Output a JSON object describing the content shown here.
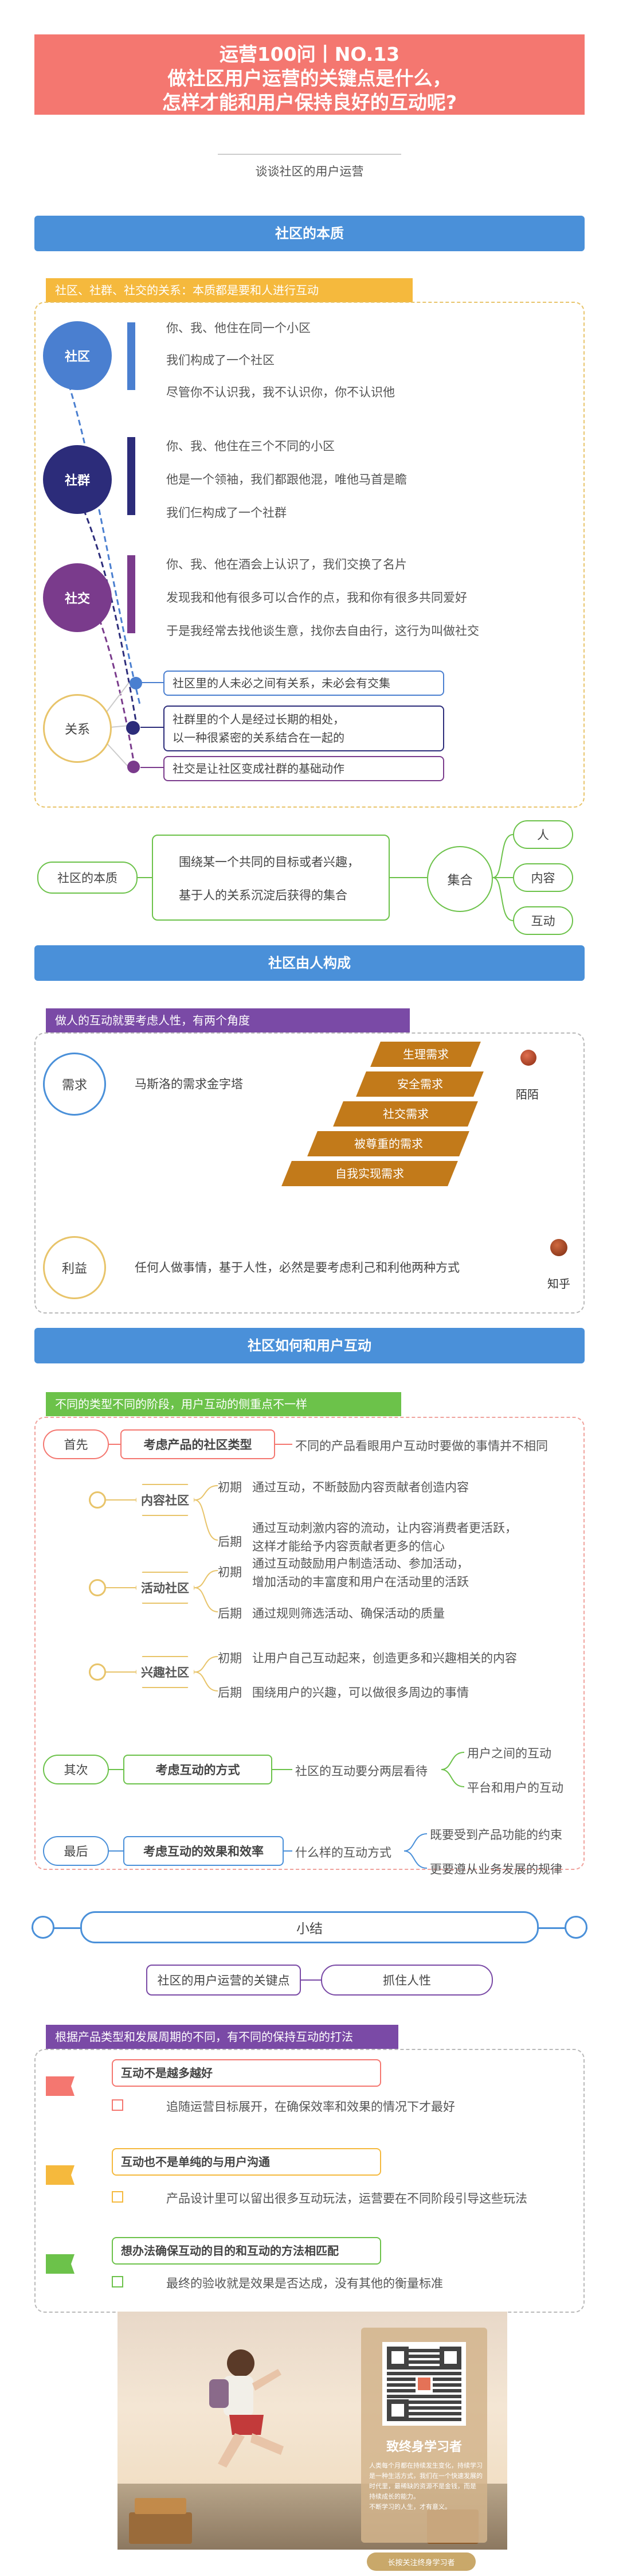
{
  "header": {
    "line1": "运营100问丨NO.13",
    "line2": "做社区用户运营的关键点是什么，",
    "line3": "怎样才能和用户保持良好的互动呢?"
  },
  "subtitle": "谈谈社区的用户运营",
  "sec1": {
    "title": "社区的本质",
    "tag": "社区、社群、社交的关系：本质都是要和人进行互动",
    "community": {
      "label": "社区",
      "lines": [
        "你、我、他住在同一个小区",
        "我们构成了一个社区",
        "尽管你不认识我，我不认识你，你不认识他"
      ]
    },
    "group": {
      "label": "社群",
      "lines": [
        "你、我、他住在三个不同的小区",
        "他是一个领袖，我们都跟他混，唯他马首是瞻",
        "我们仨构成了一个社群"
      ]
    },
    "social": {
      "label": "社交",
      "lines": [
        "你、我、他在酒会上认识了，我们交换了名片",
        "发现我和他有很多可以合作的点，我和你有很多共同爱好",
        "于是我经常去找他谈生意，找你去自由行，这行为叫做社交"
      ]
    },
    "relation": {
      "label": "关系",
      "items": [
        "社区里的人未必之间有关系，未必会有交集",
        "社群里的个人是经过长期的相处，\n以一种很紧密的关系结合在一起的",
        "社交是让社区变成社群的基础动作"
      ]
    },
    "essence": {
      "label": "社区的本质",
      "desc1": "围绕某一个共同的目标或者兴趣，",
      "desc2": "基于人的关系沉淀后获得的集合",
      "set": "集合",
      "items": [
        "人",
        "内容",
        "互动"
      ]
    }
  },
  "sec2": {
    "title": "社区由人构成",
    "tag": "做人的互动就要考虑人性，有两个角度",
    "need": {
      "label": "需求",
      "desc": "马斯洛的需求金字塔",
      "levels": [
        "生理需求",
        "安全需求",
        "社交需求",
        "被尊重的需求",
        "自我实现需求"
      ],
      "brand": "陌陌"
    },
    "benefit": {
      "label": "利益",
      "desc": "任何人做事情，基于人性，必然是要考虑利己和利他两种方式",
      "brand": "知乎"
    }
  },
  "sec3": {
    "title": "社区如何和用户互动",
    "tag": "不同的类型不同的阶段，用户互动的侧重点不一样",
    "first": {
      "label": "首先",
      "topic": "考虑产品的社区类型",
      "result": "不同的产品看眼用户互动时要做的事情并不相同"
    },
    "types": [
      {
        "label": "内容社区",
        "early": "初期",
        "early_text": "通过互动，不断鼓励内容贡献者创造内容",
        "late": "后期",
        "late_text": "通过互动刺激内容的流动，让内容消费者更活跃，\n这样才能给予内容贡献者更多的信心"
      },
      {
        "label": "活动社区",
        "early": "初期",
        "early_text": "通过互动鼓励用户制造活动、参加活动，\n增加活动的丰富度和用户在活动里的活跃",
        "late": "后期",
        "late_text": "通过规则筛选活动、确保活动的质量"
      },
      {
        "label": "兴趣社区",
        "early": "初期",
        "early_text": "让用户自己互动起来，创造更多和兴趣相关的内容",
        "late": "后期",
        "late_text": "围绕用户的兴趣，可以做很多周边的事情"
      }
    ],
    "second": {
      "label": "其次",
      "topic": "考虑互动的方式",
      "desc": "社区的互动要分两层看待",
      "items": [
        "用户之间的互动",
        "平台和用户的互动"
      ]
    },
    "last": {
      "label": "最后",
      "topic": "考虑互动的效果和效率",
      "desc": "什么样的互动方式",
      "items": [
        "既要受到产品功能的约束",
        "更要遵从业务发展的规律"
      ]
    }
  },
  "summary": {
    "title": "小结",
    "key_left": "社区的用户运营的关键点",
    "key_right": "抓住人性",
    "tag": "根据产品类型和发展周期的不同，有不同的保持互动的打法",
    "points": [
      {
        "title": "互动不是越多越好",
        "desc": "追随运营目标展开，在确保效率和效果的情况下才最好",
        "color": "#f47770"
      },
      {
        "title": "互动也不是单纯的与用户沟通",
        "desc": "产品设计里可以留出很多互动玩法，运营要在不同阶段引导这些玩法",
        "color": "#f5b93d"
      },
      {
        "title": "想办法确保互动的目的和互动的方法相匹配",
        "desc": "最终的验收就是效果是否达成，没有其他的衡量标准",
        "color": "#6cc24a"
      }
    ]
  },
  "footer": {
    "qr_title": "致终身学习者",
    "qr_lines": [
      "人类每个月都在持续发生变化，持续学习",
      "是一种生活方式，我们在一个快速发展的",
      "时代里，最稀缺的资源不是金钱，而是",
      "持续成长的能力。",
      "不断学习的人生，才有意义。"
    ],
    "button": "长按关注终身学习者"
  }
}
